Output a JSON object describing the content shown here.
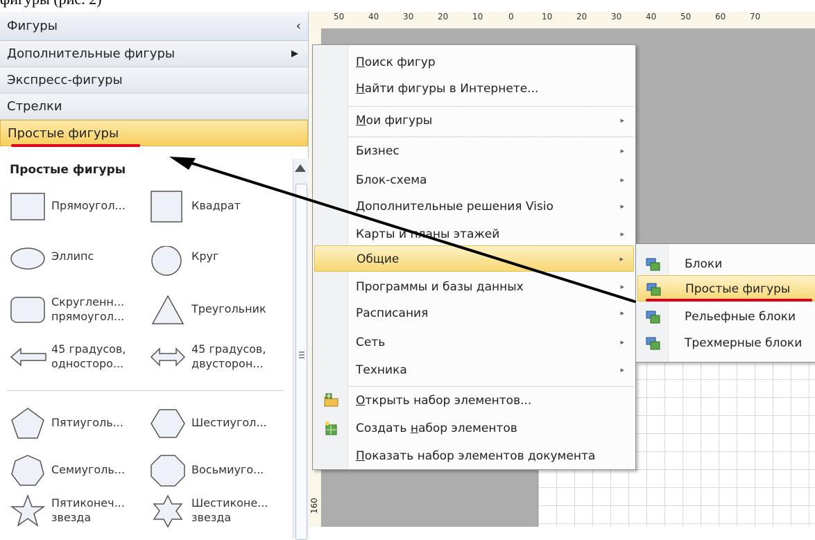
{
  "caption": "фигуры (рис. 2)",
  "panel": {
    "header": "Фигуры",
    "collapse_glyph": "‹",
    "rows": [
      {
        "label": "Дополнительные фигуры",
        "arrow": "▶"
      },
      {
        "label": "Экспресс-фигуры"
      },
      {
        "label": "Стрелки"
      },
      {
        "label": "Простые фигуры"
      }
    ],
    "shapes_title": "Простые фигуры",
    "shapes": [
      {
        "icon": "rectangle-shape-icon",
        "label": "Прямоугол..."
      },
      {
        "icon": "square-shape-icon",
        "label": "Квадрат"
      },
      {
        "icon": "ellipse-shape-icon",
        "label": "Эллипс"
      },
      {
        "icon": "circle-shape-icon",
        "label": "Круг"
      },
      {
        "icon": "rounded-rectangle-shape-icon",
        "label": "Скругленн...\nпрямоугол..."
      },
      {
        "icon": "triangle-shape-icon",
        "label": "Треугольник"
      },
      {
        "icon": "one-sided-arrow-icon",
        "label": "45 градусов,\nодносторо..."
      },
      {
        "icon": "two-sided-arrow-icon",
        "label": "45 градусов,\nдвусторон..."
      },
      {
        "icon": "pentagon-shape-icon",
        "label": "Пятиуголь..."
      },
      {
        "icon": "hexagon-shape-icon",
        "label": "Шестиугол..."
      },
      {
        "icon": "heptagon-shape-icon",
        "label": "Семиуголь..."
      },
      {
        "icon": "octagon-shape-icon",
        "label": "Восьмиуго..."
      },
      {
        "icon": "five-point-star-icon",
        "label": "Пятиконеч...\nзвезда"
      },
      {
        "icon": "six-point-star-icon",
        "label": "Шестиконе...\nзвезда"
      }
    ]
  },
  "ruler": {
    "top_labels": [
      "50",
      "40",
      "30",
      "20",
      "10",
      "0",
      "10",
      "20",
      "30",
      "40",
      "50",
      "60",
      "70"
    ],
    "left_label": "160"
  },
  "menu": {
    "items": [
      {
        "label": "Поиск фигур",
        "u": "П",
        "rest": "оиск фигур",
        "sub": false
      },
      {
        "label": "Найти фигуры в Интернете...",
        "u": "Н",
        "rest": "айти фигуры в Интернете...",
        "sub": false
      },
      {
        "label": "Мои фигуры",
        "u": "М",
        "rest": "ои фигуры",
        "sub": true
      },
      {
        "label": "Бизнес",
        "sub": true
      },
      {
        "label": "Блок-схема",
        "sub": true
      },
      {
        "label": "Дополнительные решения Visio",
        "sub": true
      },
      {
        "label": "Карты и планы этажей",
        "sub": true
      },
      {
        "label": "Общие",
        "sub": true
      },
      {
        "label": "Программы и базы данных",
        "sub": true
      },
      {
        "label": "Расписания",
        "sub": true
      },
      {
        "label": "Сеть",
        "sub": true
      },
      {
        "label": "Техника",
        "sub": true
      },
      {
        "label": "Открыть набор элементов...",
        "u": "О",
        "rest": "ткрыть набор элементов...",
        "sub": false
      },
      {
        "label": "Создать набор элементов",
        "pre": "Создать ",
        "u": "н",
        "rest": "абор элементов",
        "sub": false
      },
      {
        "label": "Показать набор элементов документа",
        "u": "П",
        "rest": "оказать набор элементов документа",
        "sub": false
      }
    ],
    "submenu_glyph": "▸"
  },
  "submenu": {
    "items": [
      {
        "label": "Блоки"
      },
      {
        "label": "Простые фигуры"
      },
      {
        "label": "Рельефные блоки"
      },
      {
        "label": "Трехмерные блоки"
      }
    ]
  },
  "colors": {
    "highlight": "#f8d873",
    "annotation_red": "#e0001b",
    "annotation_arrow": "#000000"
  }
}
